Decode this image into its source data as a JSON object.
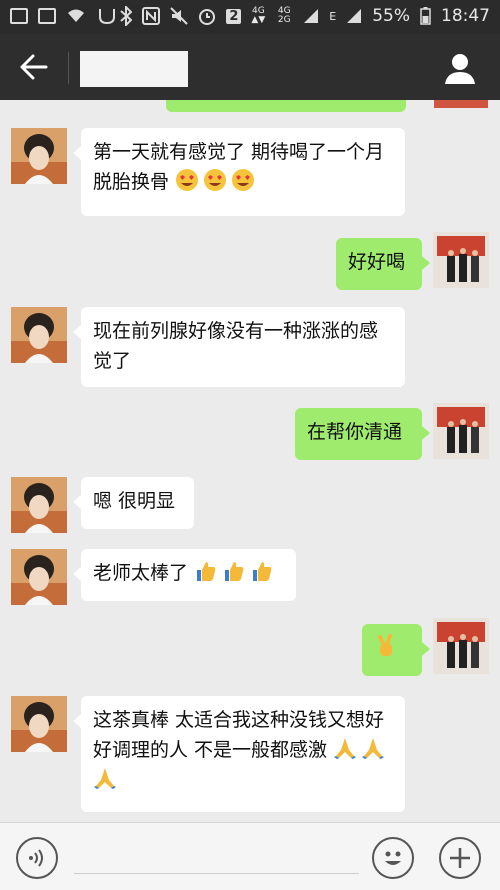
{
  "status_bar": {
    "network_small": "4G",
    "network_small2": "4G 2G",
    "sim_indicator": "E",
    "battery": "55%",
    "time": "18:47",
    "sim_badge": "2"
  },
  "header": {
    "contact_name": ""
  },
  "messages": [
    {
      "side": "left",
      "text": "第一天就有感觉了 期待喝了一个月 脱胎换骨",
      "emojis": [
        "heart-eyes",
        "heart-eyes",
        "heart-eyes"
      ]
    },
    {
      "side": "right",
      "text": "好好喝"
    },
    {
      "side": "left",
      "text": "现在前列腺好像没有一种涨涨的感觉了"
    },
    {
      "side": "right",
      "text": "在帮你清通"
    },
    {
      "side": "left",
      "text": "嗯 很明显"
    },
    {
      "side": "left",
      "text": "老师太棒了",
      "emojis": [
        "thumbs-up",
        "thumbs-up",
        "thumbs-up"
      ]
    },
    {
      "side": "right",
      "text": "",
      "emojis": [
        "victory-hand"
      ]
    },
    {
      "side": "left",
      "text": "这茶真棒 太适合我这种没钱又想好好调理的人 不是一般都感激",
      "emojis": [
        "praying-hands",
        "praying-hands",
        "praying-hands"
      ]
    }
  ],
  "colors": {
    "outgoing_bubble": "#9feb6e",
    "incoming_bubble": "#ffffff",
    "header": "#2e2e2e",
    "chat_bg": "#ebebeb"
  }
}
